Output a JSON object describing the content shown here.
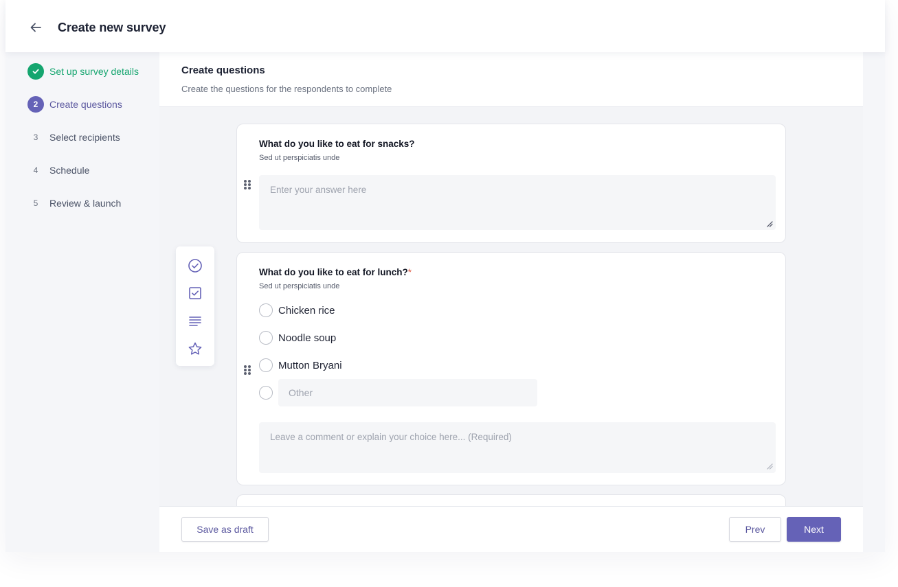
{
  "header": {
    "title": "Create new survey",
    "back_icon": "arrow-left-icon"
  },
  "steps": [
    {
      "marker": "",
      "label": "Set up survey details",
      "state": "done"
    },
    {
      "marker": "2",
      "label": "Create questions",
      "state": "active"
    },
    {
      "marker": "3",
      "label": "Select recipients",
      "state": "todo"
    },
    {
      "marker": "4",
      "label": "Schedule",
      "state": "todo"
    },
    {
      "marker": "5",
      "label": "Review & launch",
      "state": "todo"
    }
  ],
  "panel": {
    "title": "Create questions",
    "subtitle": "Create the questions for the respondents to complete"
  },
  "toolbox": [
    "check-circle-icon",
    "checkbox-icon",
    "paragraph-icon",
    "star-icon"
  ],
  "questions": [
    {
      "title": "What do you like to eat for snacks?",
      "description": "Sed ut perspiciatis unde",
      "answer_placeholder": "Enter your answer here"
    },
    {
      "title": "What do you like to eat for lunch?",
      "required_mark": "*",
      "description": "Sed ut perspiciatis unde",
      "options": [
        "Chicken rice",
        "Noodle soup",
        "Mutton Bryani"
      ],
      "other_placeholder": "Other",
      "comment_placeholder": "Leave a comment or explain your choice here... (Required)"
    }
  ],
  "footer": {
    "save_draft": "Save as draft",
    "prev": "Prev",
    "next": "Next"
  },
  "colors": {
    "primary": "#6562b7",
    "success": "#15a56f",
    "required": "#e0604a"
  }
}
